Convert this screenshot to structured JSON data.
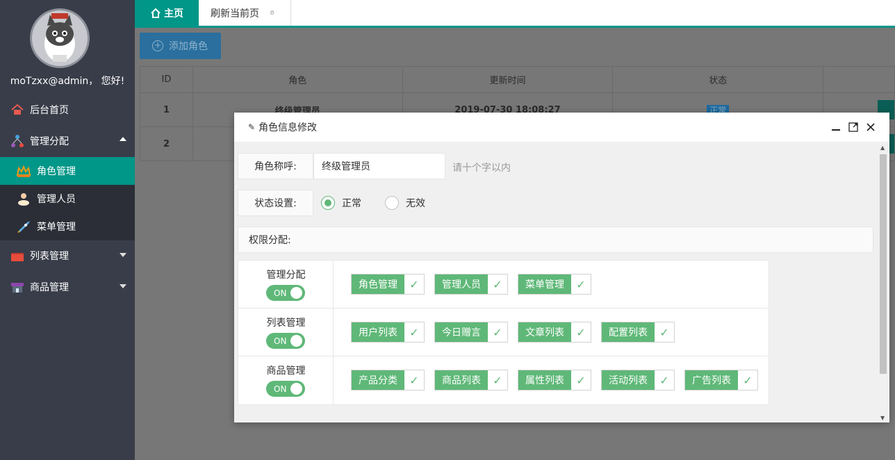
{
  "sidebar": {
    "greeting": "moTzxx@admin， 您好!",
    "items": [
      {
        "label": "后台首页",
        "icon": "home-icon"
      },
      {
        "label": "管理分配",
        "icon": "network-icon"
      },
      {
        "label": "列表管理",
        "icon": "list-icon"
      },
      {
        "label": "商品管理",
        "icon": "store-icon"
      }
    ],
    "subitems": [
      {
        "label": "角色管理",
        "icon": "crown-icon"
      },
      {
        "label": "管理人员",
        "icon": "user-icon"
      },
      {
        "label": "菜单管理",
        "icon": "rocket-icon"
      }
    ]
  },
  "tabs": {
    "home": "主页",
    "refresh": "刷新当前页",
    "close_glyph": "ი"
  },
  "main": {
    "add_button": "添加角色",
    "table": {
      "headers": [
        "ID",
        "角色",
        "更新时间",
        "状态"
      ],
      "rows": [
        {
          "id": "1",
          "role": "终级管理员",
          "time": "2019-07-30 18:08:27",
          "status": "正常"
        },
        {
          "id": "2",
          "role": "",
          "time": "",
          "status": ""
        }
      ]
    }
  },
  "dialog": {
    "title": "角色信息修改",
    "name_label": "角色称呼:",
    "name_value": "终级管理员",
    "name_hint": "请十个字以内",
    "status_label": "状态设置:",
    "status_options": [
      "正常",
      "无效"
    ],
    "status_selected": "正常",
    "perm_label": "权限分配:",
    "switch_text": "ON",
    "groups": [
      {
        "name": "管理分配",
        "items": [
          "角色管理",
          "管理人员",
          "菜单管理"
        ]
      },
      {
        "name": "列表管理",
        "items": [
          "用户列表",
          "今日赠言",
          "文章列表",
          "配置列表"
        ]
      },
      {
        "name": "商品管理",
        "items": [
          "产品分类",
          "商品列表",
          "属性列表",
          "活动列表",
          "广告列表"
        ]
      }
    ]
  },
  "colors": {
    "sidebar": "#393d49",
    "accent": "#009688",
    "check_green": "#5fb878"
  }
}
